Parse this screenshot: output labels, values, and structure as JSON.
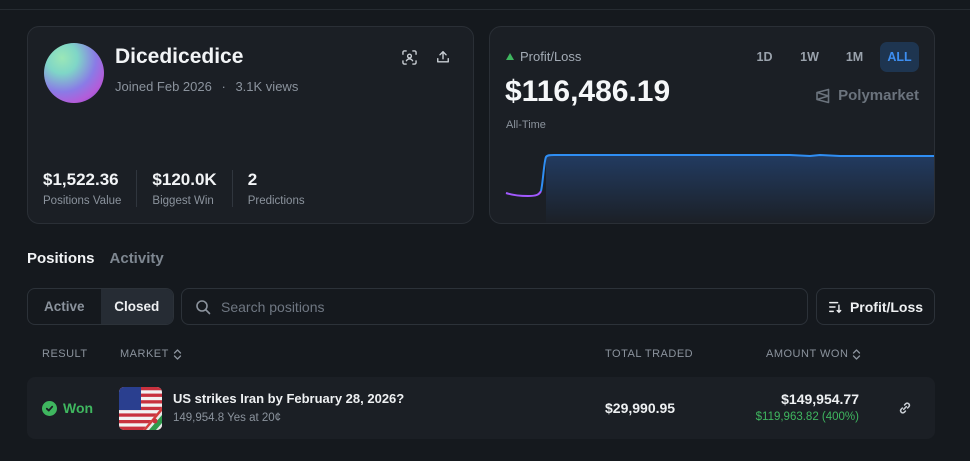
{
  "profile": {
    "username": "Dicedicedice",
    "joined": "Joined Feb 2026",
    "separator": "·",
    "views": "3.1K views",
    "stats": [
      {
        "value": "$1,522.36",
        "label": "Positions Value"
      },
      {
        "value": "$120.0K",
        "label": "Biggest Win"
      },
      {
        "value": "2",
        "label": "Predictions"
      }
    ]
  },
  "pnl": {
    "label": "Profit/Loss",
    "value": "$116,486.19",
    "period": "All-Time",
    "ranges": [
      "1D",
      "1W",
      "1M",
      "ALL"
    ],
    "active_range": "ALL",
    "brand": "Polymarket",
    "colors": {
      "line_before": "#a259ff",
      "line_after": "#2f8ef4",
      "up": "#3fb65f"
    }
  },
  "tabs": [
    "Positions",
    "Activity"
  ],
  "filters": {
    "active_label": "Active",
    "closed_label": "Closed",
    "selected": "Closed"
  },
  "search": {
    "placeholder": "Search positions"
  },
  "sort": {
    "label": "Profit/Loss"
  },
  "table": {
    "headers": {
      "result": "RESULT",
      "market": "MARKET",
      "total_traded": "TOTAL TRADED",
      "amount_won": "AMOUNT WON"
    },
    "rows": [
      {
        "result": "Won",
        "title": "US strikes Iran by February 28, 2026?",
        "subtitle": "149,954.8 Yes at 20¢",
        "total_traded": "$29,990.95",
        "amount_won": "$149,954.77",
        "profit": "$119,963.82 (400%)"
      }
    ]
  }
}
